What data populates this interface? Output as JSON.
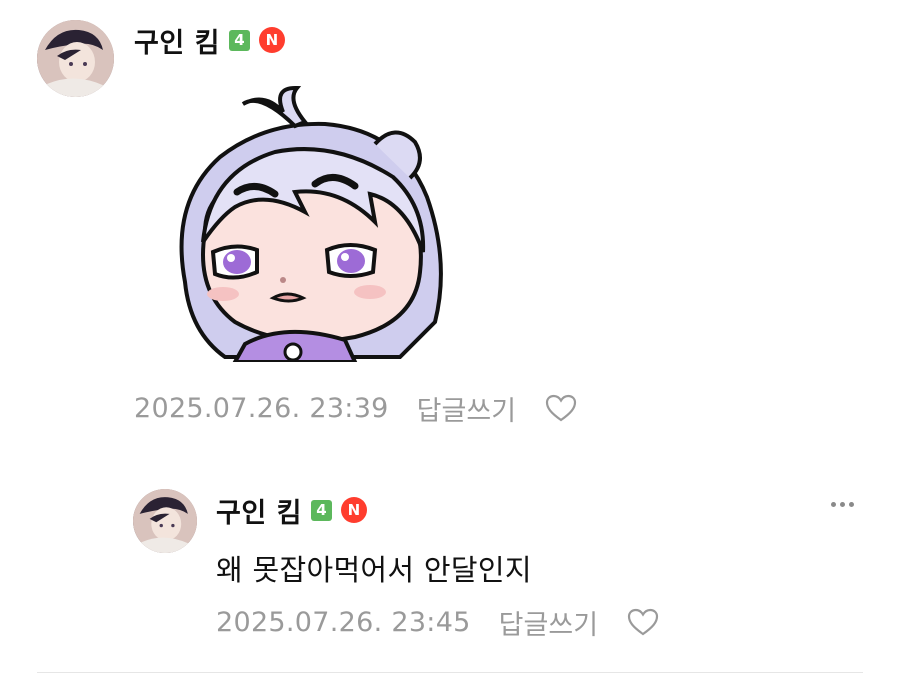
{
  "comments": [
    {
      "nickname": "구인 킴",
      "level": "4",
      "new_badge": "N",
      "timestamp": "2025.07.26. 23:39",
      "reply_label": "답글쓰기",
      "has_sticker": true
    },
    {
      "nickname": "구인 킴",
      "level": "4",
      "new_badge": "N",
      "text": "왜 못잡아먹어서 안달인지",
      "timestamp": "2025.07.26. 23:45",
      "reply_label": "답글쓰기"
    }
  ],
  "colors": {
    "level_badge": "#5cb85c",
    "new_badge": "#ff3d2e",
    "meta_text": "#9a9a9a",
    "divider": "#e6e6e6"
  },
  "icons": {
    "like": "heart-outline-icon",
    "more": "more-horizontal-icon"
  }
}
